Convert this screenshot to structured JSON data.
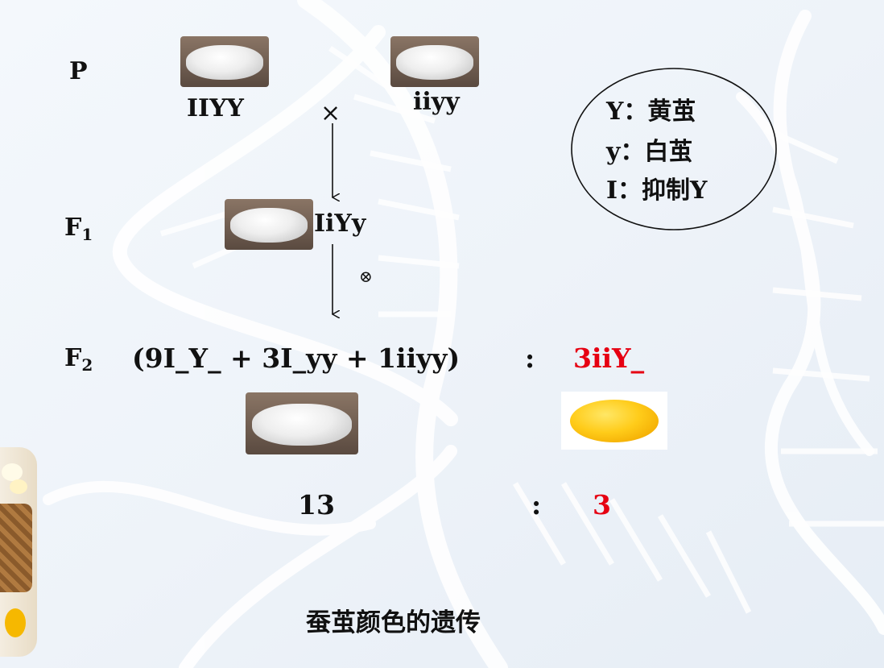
{
  "generations": {
    "p": "P",
    "f1_base": "F",
    "f1_sub": "1",
    "f2_base": "F",
    "f2_sub": "2"
  },
  "parents": {
    "left_genotype": "IIYY",
    "right_genotype": "iiyy",
    "cross_symbol": "×"
  },
  "f1": {
    "genotype": "IiYy",
    "self_symbol": "⊗"
  },
  "f2": {
    "expression_white": "(9I_Y_ + 3I_yy + 1iiyy)",
    "colon": ":",
    "expression_yellow": "3iiY_",
    "ratio_white": "13",
    "ratio_colon": ":",
    "ratio_yellow": "3"
  },
  "legend": {
    "line1": "Y：黄茧",
    "line2": "y：白茧",
    "line3": "I：抑制Y"
  },
  "caption": "蚕茧颜色的遗传",
  "colors": {
    "highlight": "#e60012",
    "text": "#111111",
    "background": "#f1f6fb"
  },
  "images": {
    "white_cocoon": "white-cocoon-photo",
    "yellow_cocoon": "yellow-cocoon-photo",
    "decoration": "dna-helix-background"
  }
}
